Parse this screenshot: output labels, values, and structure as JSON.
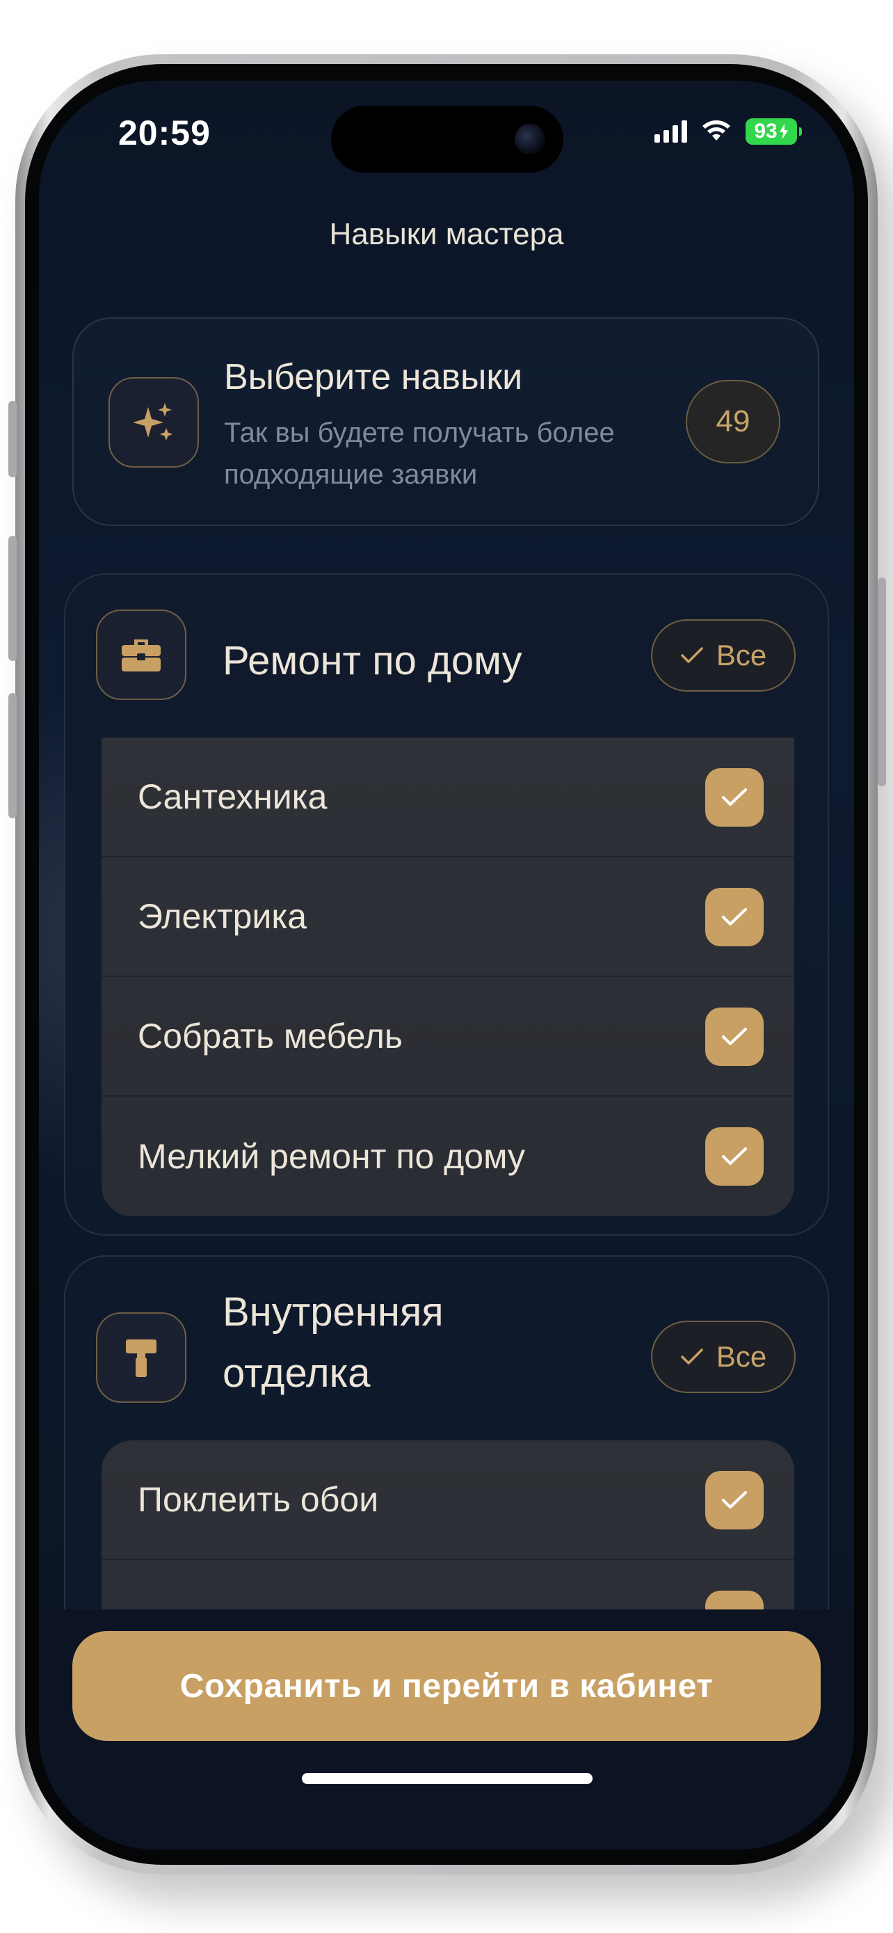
{
  "status_bar": {
    "time": "20:59",
    "battery": "93",
    "battery_color": "#32d74b"
  },
  "header": {
    "title": "Навыки мастера"
  },
  "info_card": {
    "icon": "sparkles-icon",
    "title": "Выберите навыки",
    "subtitle": "Так вы будете получать более подходящие заявки",
    "count": "49"
  },
  "categories": [
    {
      "icon": "toolbox-icon",
      "title": "Ремонт по дому",
      "all_label": "Все",
      "skills": [
        {
          "label": "Сантехника",
          "checked": true
        },
        {
          "label": "Электрика",
          "checked": true
        },
        {
          "label": "Собрать мебель",
          "checked": true
        },
        {
          "label": "Мелкий ремонт по дому",
          "checked": true
        }
      ]
    },
    {
      "icon": "paint-roller-icon",
      "title": "Внутренняя отделка",
      "all_label": "Все",
      "skills": [
        {
          "label": "Поклеить обои",
          "checked": true
        }
      ]
    }
  ],
  "footer": {
    "save_label": "Сохранить и перейти в кабинет"
  },
  "colors": {
    "accent": "#c9a064",
    "background": "#0e1a30",
    "text": "#ece5d8",
    "muted": "#7f8aa0"
  }
}
